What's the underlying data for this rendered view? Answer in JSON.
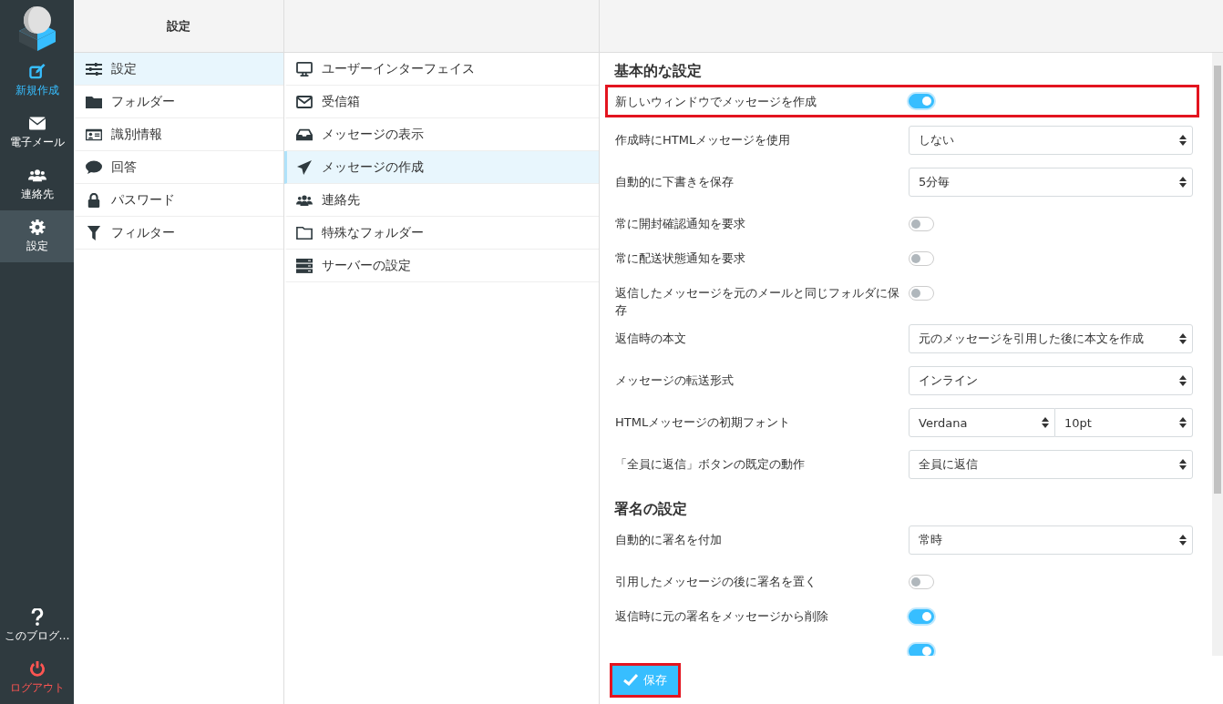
{
  "nav": {
    "items": [
      {
        "label": "新規作成",
        "kind": "action",
        "selected": false
      },
      {
        "label": "電子メール",
        "kind": "nav",
        "selected": false
      },
      {
        "label": "連絡先",
        "kind": "nav",
        "selected": false
      },
      {
        "label": "設定",
        "kind": "nav",
        "selected": true
      }
    ],
    "bottom_items": [
      {
        "label": "このブログ…",
        "kind": "nav"
      },
      {
        "label": "ログアウト",
        "kind": "logout"
      }
    ]
  },
  "sections": {
    "title": "設定",
    "items": [
      {
        "label": "設定",
        "selected": true
      },
      {
        "label": "フォルダー",
        "selected": false
      },
      {
        "label": "識別情報",
        "selected": false
      },
      {
        "label": "回答",
        "selected": false
      },
      {
        "label": "パスワード",
        "selected": false
      },
      {
        "label": "フィルター",
        "selected": false
      }
    ]
  },
  "subsections": {
    "items": [
      {
        "label": "ユーザーインターフェイス",
        "selected": false
      },
      {
        "label": "受信箱",
        "selected": false
      },
      {
        "label": "メッセージの表示",
        "selected": false
      },
      {
        "label": "メッセージの作成",
        "selected": true
      },
      {
        "label": "連絡先",
        "selected": false
      },
      {
        "label": "特殊なフォルダー",
        "selected": false
      },
      {
        "label": "サーバーの設定",
        "selected": false
      }
    ]
  },
  "form": {
    "groups": [
      {
        "title": "基本的な設定",
        "rows": [
          {
            "label": "新しいウィンドウでメッセージを作成",
            "kind": "toggle",
            "on": true,
            "highlighted": true
          },
          {
            "label": "作成時にHTMLメッセージを使用",
            "kind": "select",
            "values": [
              "しない"
            ]
          },
          {
            "label": "自動的に下書きを保存",
            "kind": "select",
            "values": [
              "5分毎"
            ]
          },
          {
            "label": "常に開封確認通知を要求",
            "kind": "toggle",
            "on": false
          },
          {
            "label": "常に配送状態通知を要求",
            "kind": "toggle",
            "on": false
          },
          {
            "label": "返信したメッセージを元のメールと同じフォルダに保存",
            "kind": "toggle",
            "on": false
          },
          {
            "label": "返信時の本文",
            "kind": "select",
            "values": [
              "元のメッセージを引用した後に本文を作成"
            ]
          },
          {
            "label": "メッセージの転送形式",
            "kind": "select",
            "values": [
              "インライン"
            ]
          },
          {
            "label": "HTMLメッセージの初期フォント",
            "kind": "select",
            "values": [
              "Verdana",
              "10pt"
            ]
          },
          {
            "label": "「全員に返信」ボタンの既定の動作",
            "kind": "select",
            "values": [
              "全員に返信"
            ]
          }
        ]
      },
      {
        "title": "署名の設定",
        "rows": [
          {
            "label": "自動的に署名を付加",
            "kind": "select",
            "values": [
              "常時"
            ]
          },
          {
            "label": "引用したメッセージの後に署名を置く",
            "kind": "toggle",
            "on": false
          },
          {
            "label": "返信時に元の署名をメッセージから削除",
            "kind": "toggle",
            "on": true
          },
          {
            "kind": "toggle",
            "on": true
          }
        ]
      }
    ]
  },
  "save_button": {
    "label": "保存",
    "highlighted": true
  }
}
